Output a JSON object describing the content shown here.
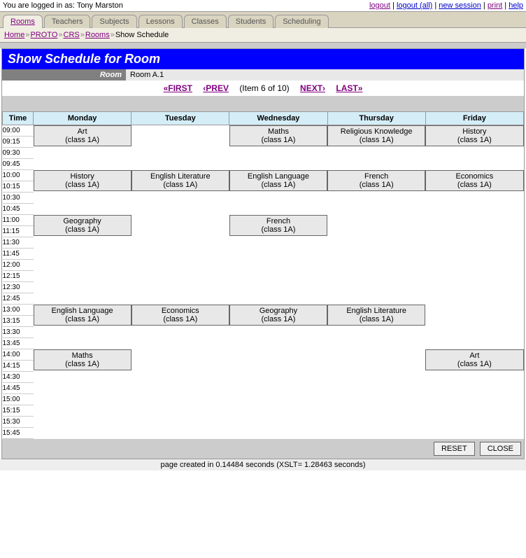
{
  "user": {
    "prefix": "You are logged in as: ",
    "name": "Tony Marston"
  },
  "toplinks": {
    "logout": "logout",
    "logout_all": "logout (all)",
    "new_session": "new session",
    "print": "print",
    "help": "help"
  },
  "tabs": [
    "Rooms",
    "Teachers",
    "Subjects",
    "Lessons",
    "Classes",
    "Students",
    "Scheduling"
  ],
  "crumbs": {
    "home": "Home",
    "proto": "PROTO",
    "crs": "CRS",
    "rooms": "Rooms",
    "leaf": "Show Schedule"
  },
  "title": "Show Schedule for Room",
  "room": {
    "label": "Room",
    "value": "Room A.1"
  },
  "pager": {
    "first": "«FIRST",
    "prev": "‹PREV",
    "info": "(Item 6 of 10)",
    "next": "NEXT›",
    "last": "LAST»"
  },
  "days": [
    "Monday",
    "Tuesday",
    "Wednesday",
    "Thursday",
    "Friday"
  ],
  "timehdr": "Time",
  "times": [
    "09:00",
    "09:15",
    "09:30",
    "09:45",
    "10:00",
    "10:15",
    "10:30",
    "10:45",
    "11:00",
    "11:15",
    "11:30",
    "11:45",
    "12:00",
    "12:15",
    "12:30",
    "12:45",
    "13:00",
    "13:15",
    "13:30",
    "13:45",
    "14:00",
    "14:15",
    "14:30",
    "14:45",
    "15:00",
    "15:15",
    "15:30",
    "15:45"
  ],
  "cells": {
    "mon_09": {
      "subj": "Art",
      "cls": "(class 1A)"
    },
    "wed_09": {
      "subj": "Maths",
      "cls": "(class 1A)"
    },
    "thu_09": {
      "subj": "Religious Knowledge",
      "cls": "(class 1A)"
    },
    "fri_09": {
      "subj": "History",
      "cls": "(class 1A)"
    },
    "mon_10": {
      "subj": "History",
      "cls": "(class 1A)"
    },
    "tue_10": {
      "subj": "English Literature",
      "cls": "(class 1A)"
    },
    "wed_10": {
      "subj": "English Language",
      "cls": "(class 1A)"
    },
    "thu_10": {
      "subj": "French",
      "cls": "(class 1A)"
    },
    "fri_10": {
      "subj": "Economics",
      "cls": "(class 1A)"
    },
    "mon_11": {
      "subj": "Geography",
      "cls": "(class 1A)"
    },
    "wed_11": {
      "subj": "French",
      "cls": "(class 1A)"
    },
    "mon_13": {
      "subj": "English Language",
      "cls": "(class 1A)"
    },
    "tue_13": {
      "subj": "Economics",
      "cls": "(class 1A)"
    },
    "wed_13": {
      "subj": "Geography",
      "cls": "(class 1A)"
    },
    "thu_13": {
      "subj": "English Literature",
      "cls": "(class 1A)"
    },
    "mon_14": {
      "subj": "Maths",
      "cls": "(class 1A)"
    },
    "fri_14": {
      "subj": "Art",
      "cls": "(class 1A)"
    }
  },
  "buttons": {
    "reset": "RESET",
    "close": "CLOSE"
  },
  "footer": "page created in 0.14484 seconds (XSLT= 1.28463 seconds)"
}
